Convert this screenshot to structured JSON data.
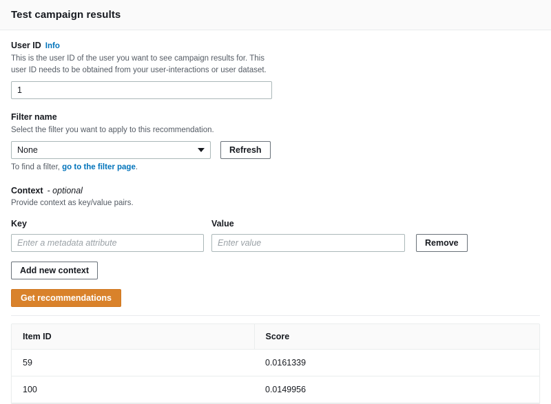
{
  "header": {
    "title": "Test campaign results"
  },
  "user_id": {
    "label": "User ID",
    "info_link": "Info",
    "description": "This is the user ID of the user you want to see campaign results for. This user ID needs to be obtained from your user-interactions or user dataset.",
    "value": "1",
    "placeholder": ""
  },
  "filter": {
    "label": "Filter name",
    "description": "Select the filter you want to apply to this recommendation.",
    "selected": "None",
    "options": [
      "None"
    ],
    "refresh_label": "Refresh",
    "hint_prefix": "To find a filter, ",
    "hint_link": "go to the filter page",
    "hint_suffix": "."
  },
  "context": {
    "label": "Context",
    "optional_suffix": "- optional",
    "description": "Provide context as key/value pairs.",
    "key_column_label": "Key",
    "value_column_label": "Value",
    "rows": [
      {
        "key_value": "",
        "key_placeholder": "Enter a metadata attribute",
        "value_value": "",
        "value_placeholder": "Enter value",
        "remove_label": "Remove"
      }
    ],
    "add_label": "Add new context"
  },
  "actions": {
    "get_recommendations_label": "Get recommendations",
    "primary_color": "#d9822b"
  },
  "results_table": {
    "columns": [
      "Item ID",
      "Score"
    ],
    "rows": [
      {
        "item_id": "59",
        "score": "0.0161339"
      },
      {
        "item_id": "100",
        "score": "0.0149956"
      }
    ]
  }
}
